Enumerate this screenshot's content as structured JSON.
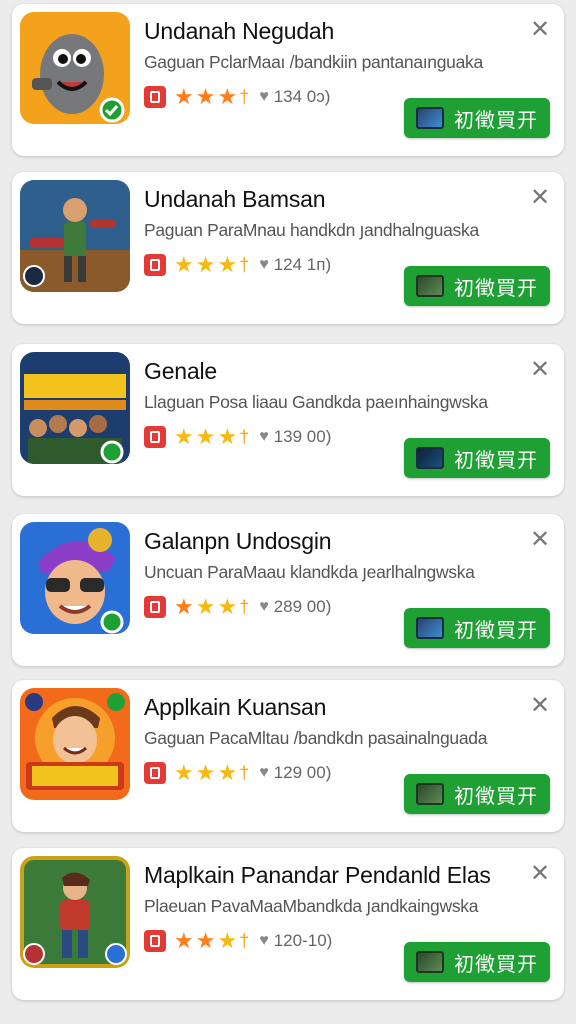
{
  "apps": [
    {
      "title": "Undanah Negudah",
      "subtitle": "Gaguan PclarMaaı /bandkiin pantanaınguaka",
      "count": "134 0ɔ)",
      "install_label": "初徵買开",
      "thumb_icon": "grey-monster-icon"
    },
    {
      "title": "Undanah Bamsan",
      "subtitle": "Paguan ParaMnau handkdn յandhalnguaska",
      "count": "124 1п)",
      "install_label": "初徵買开",
      "thumb_icon": "soldier-hero-icon"
    },
    {
      "title": "Genale",
      "subtitle": "Llaguan Posa liaau Gandkda paeınhaingwska",
      "count": "139 00)",
      "install_label": "初徵買开",
      "thumb_icon": "crowd-battle-icon"
    },
    {
      "title": "Galanpn Undosgin",
      "subtitle": "Uncuan ParaMaau klandkda յearlhalngwska",
      "count": "289 00)",
      "install_label": "初徵買开",
      "thumb_icon": "cartoon-face-icon"
    },
    {
      "title": "Applkain Kuansan",
      "subtitle": "Gaguan PacaMltau /bandkdn pasainalnguada",
      "count": "129 00)",
      "install_label": "初徵買开",
      "thumb_icon": "cartoon-boy-icon"
    },
    {
      "title": "Maplkain Panandar Pendanld Elas",
      "subtitle": "Plaeuan PavaMaaMbandkda յandkaingwska",
      "count": "120-10)",
      "install_label": "初徵買开",
      "thumb_icon": "action-hero-icon"
    }
  ]
}
